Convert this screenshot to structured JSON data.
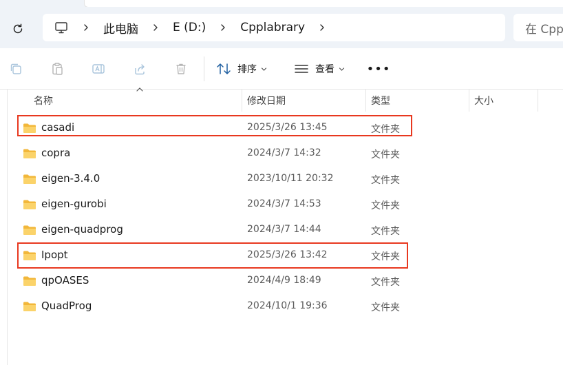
{
  "breadcrumb": {
    "items": [
      "此电脑",
      "E (D:)",
      "Cpplabrary"
    ]
  },
  "search": {
    "placeholder": "在 Cpplabrary 中搜索"
  },
  "toolbar": {
    "sort_label": "排序",
    "view_label": "查看",
    "more_label": "•••"
  },
  "columns": {
    "name": "名称",
    "modified": "修改日期",
    "type": "类型",
    "size": "大小"
  },
  "files": [
    {
      "name": "casadi",
      "modified": "2025/3/26 13:45",
      "type": "文件夹",
      "highlighted": true
    },
    {
      "name": "copra",
      "modified": "2024/3/7 14:32",
      "type": "文件夹",
      "highlighted": false
    },
    {
      "name": "eigen-3.4.0",
      "modified": "2023/10/11 20:32",
      "type": "文件夹",
      "highlighted": false
    },
    {
      "name": "eigen-gurobi",
      "modified": "2024/3/7 14:53",
      "type": "文件夹",
      "highlighted": false
    },
    {
      "name": "eigen-quadprog",
      "modified": "2024/3/7 14:44",
      "type": "文件夹",
      "highlighted": false
    },
    {
      "name": "Ipopt",
      "modified": "2025/3/26 13:42",
      "type": "文件夹",
      "highlighted": true
    },
    {
      "name": "qpOASES",
      "modified": "2024/4/9 18:49",
      "type": "文件夹",
      "highlighted": false
    },
    {
      "name": "QuadProg",
      "modified": "2024/10/1 19:36",
      "type": "文件夹",
      "highlighted": false
    }
  ],
  "colors": {
    "highlight_border": "#e8381f",
    "folder_yellow": "#f5c342",
    "toolbar_bg": "#eff3f8"
  }
}
